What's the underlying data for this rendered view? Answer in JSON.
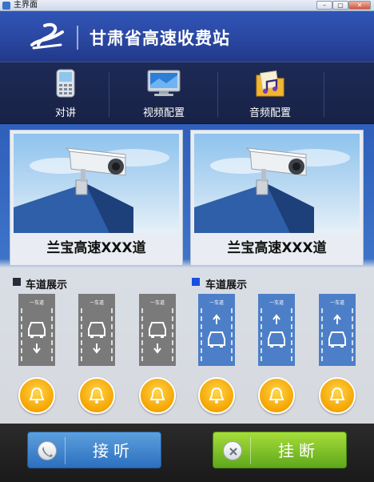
{
  "window": {
    "title": "主界面"
  },
  "header": {
    "title": "甘肃省高速收费站"
  },
  "toolbar": {
    "items": [
      {
        "label": "对讲",
        "icon": "phone-icon"
      },
      {
        "label": "视频配置",
        "icon": "monitor-icon"
      },
      {
        "label": "音频配置",
        "icon": "music-folder-icon"
      }
    ]
  },
  "cameras": [
    {
      "label": "兰宝高速XXX道"
    },
    {
      "label": "兰宝高速XXX道"
    }
  ],
  "lanes": {
    "left_group_label": "车道展示",
    "right_group_label": "车道展示",
    "lane_caption": "一车道",
    "left_group_color": "#2a2a3a",
    "right_group_color": "#1a4fe0"
  },
  "footer": {
    "answer_label": "接听",
    "hangup_label": "挂断"
  },
  "colors": {
    "header_blue": "#2c4aa6",
    "toolbar_dark": "#1b2750",
    "lane_gray": "#7b7b7b",
    "lane_blue": "#4c7fc8",
    "bell_orange": "#f5a400",
    "answer_blue": "#3e82cf",
    "hangup_green": "#7cc32a"
  }
}
